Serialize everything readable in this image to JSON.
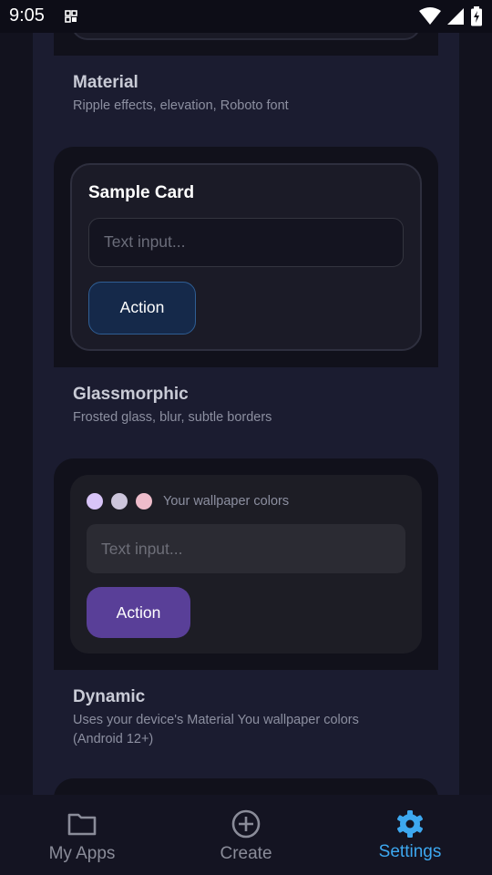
{
  "status_bar": {
    "time": "9:05"
  },
  "themes": [
    {
      "title": "Material",
      "description": "Ripple effects, elevation, Roboto font"
    },
    {
      "title": "Glassmorphic",
      "description": "Frosted glass, blur, subtle borders"
    },
    {
      "title": "Dynamic",
      "description": "Uses your device's Material You wallpaper colors (Android 12+)"
    }
  ],
  "glass_preview": {
    "card_title": "Sample Card",
    "input_placeholder": "Text input...",
    "button_label": "Action",
    "accent_color": "#15294a"
  },
  "dynamic_preview": {
    "wallpaper_label": "Your wallpaper colors",
    "swatches": [
      "#d8c4f8",
      "#cdc6dc",
      "#eebccb"
    ],
    "input_placeholder": "Text input...",
    "button_label": "Action",
    "accent_color": "#593f98"
  },
  "nav": {
    "items": [
      {
        "label": "My Apps",
        "icon": "folder-icon",
        "active": false
      },
      {
        "label": "Create",
        "icon": "add-circle-icon",
        "active": false
      },
      {
        "label": "Settings",
        "icon": "gear-icon",
        "active": true
      }
    ],
    "active_color": "#3da8f0"
  }
}
